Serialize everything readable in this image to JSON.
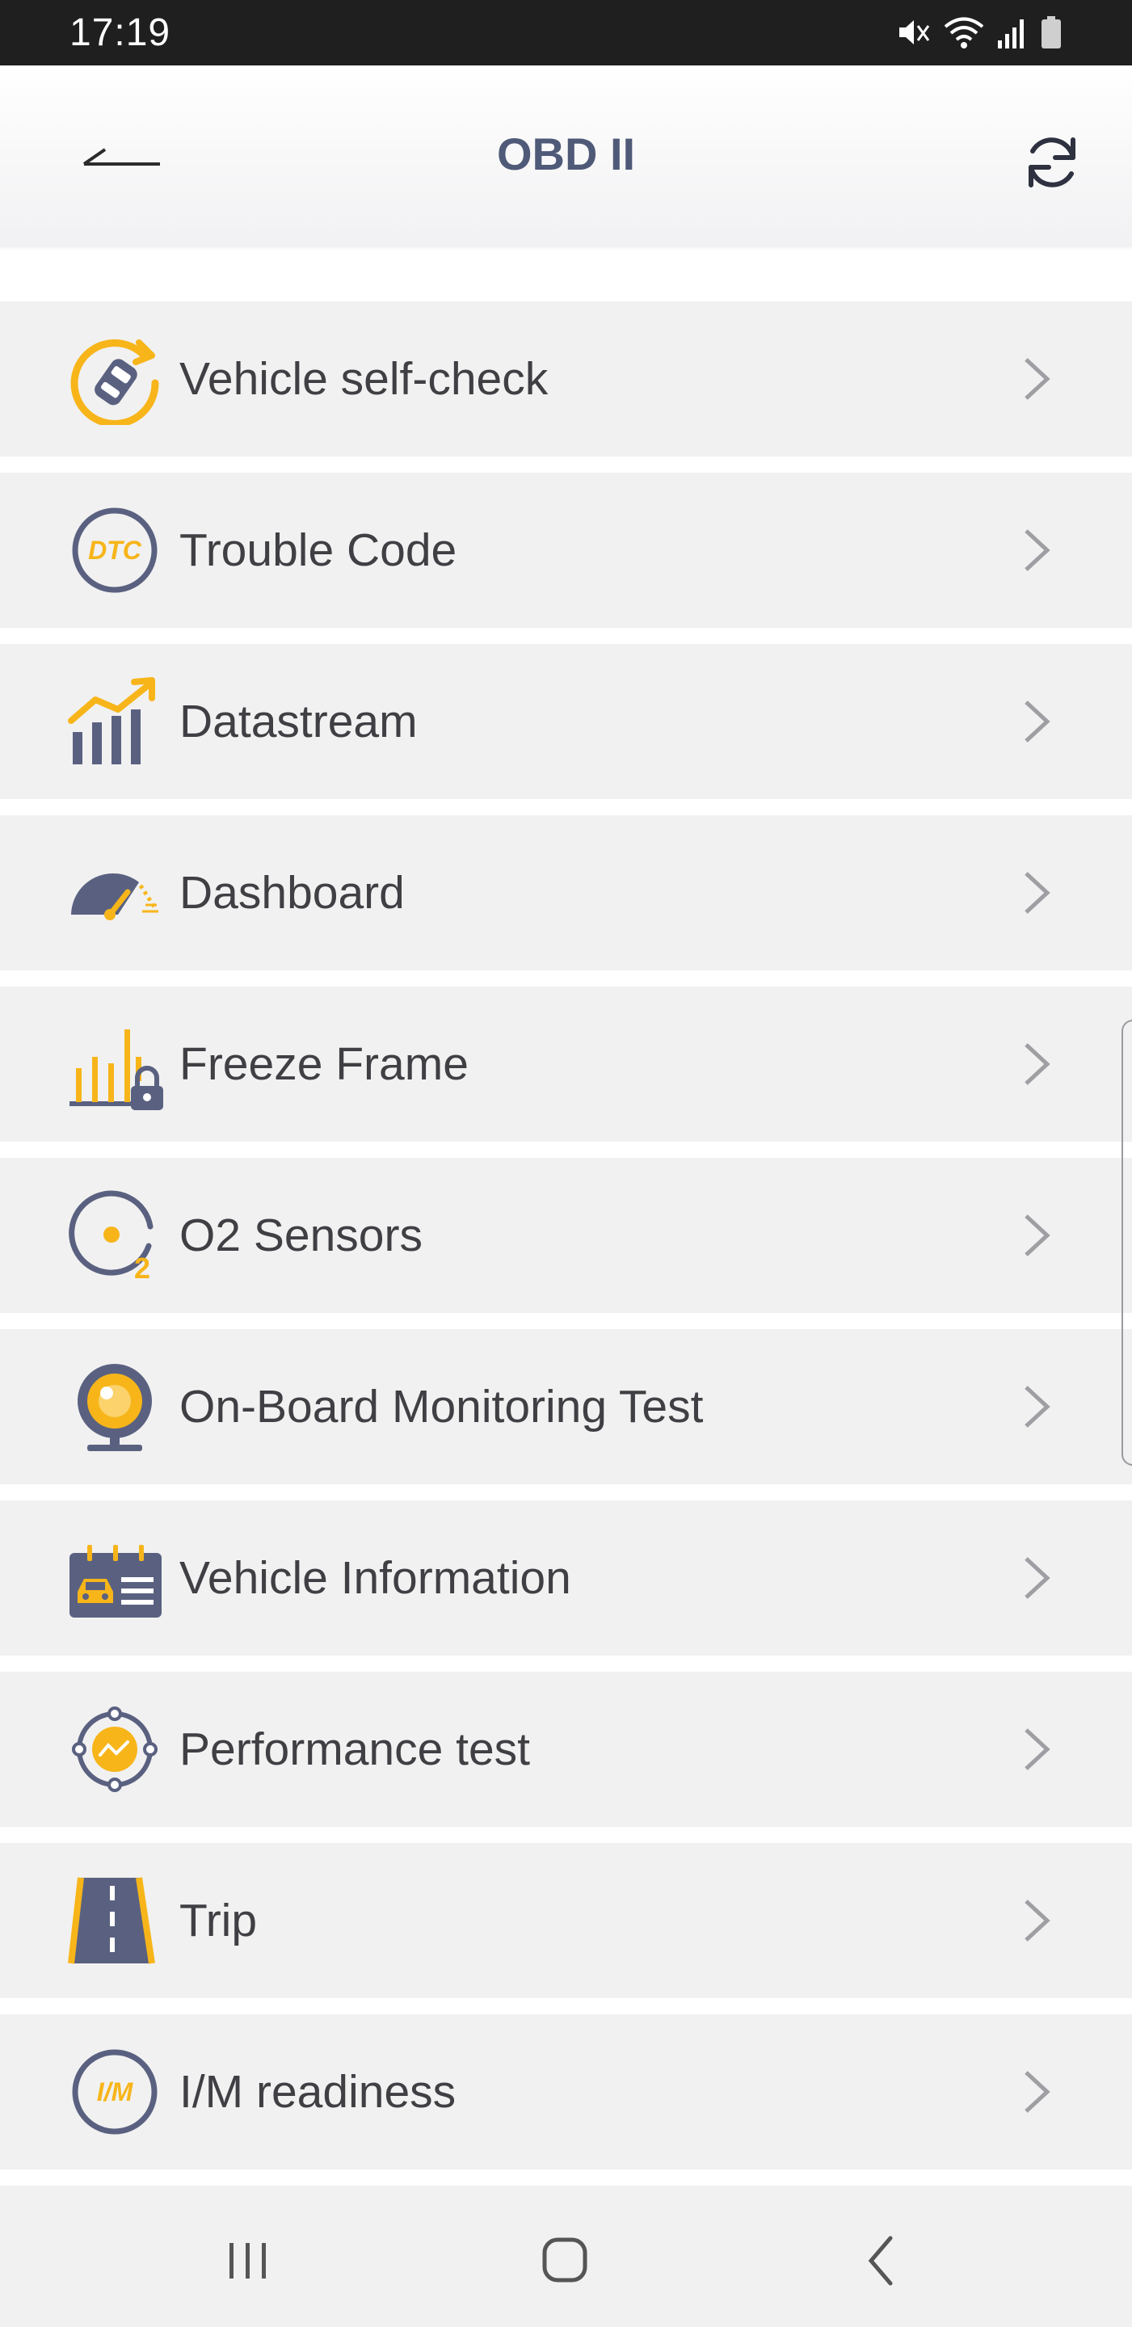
{
  "status_bar": {
    "time": "17:19",
    "icons": [
      "mute-icon",
      "wifi-icon",
      "signal-icon",
      "battery-icon"
    ]
  },
  "header": {
    "title": "OBD II",
    "back_icon": "arrow-left-icon",
    "refresh_icon": "refresh-icon"
  },
  "menu": {
    "items": [
      {
        "label": "Vehicle self-check",
        "icon": "vehicle-self-check-icon"
      },
      {
        "label": "Trouble Code",
        "icon": "dtc-icon",
        "icon_text": "DTC"
      },
      {
        "label": "Datastream",
        "icon": "datastream-chart-icon"
      },
      {
        "label": "Dashboard",
        "icon": "speedometer-icon"
      },
      {
        "label": "Freeze Frame",
        "icon": "freeze-frame-icon"
      },
      {
        "label": "O2 Sensors",
        "icon": "o2-sensor-icon",
        "icon_text": "2"
      },
      {
        "label": "On-Board Monitoring Test",
        "icon": "monitoring-camera-icon"
      },
      {
        "label": "Vehicle Information",
        "icon": "vehicle-info-card-icon"
      },
      {
        "label": "Performance test",
        "icon": "performance-test-icon"
      },
      {
        "label": "Trip",
        "icon": "road-icon"
      },
      {
        "label": "I/M readiness",
        "icon": "im-readiness-icon",
        "icon_text": "I/M"
      }
    ]
  },
  "nav_bar": {
    "recents_icon": "recents-icon",
    "home_icon": "home-icon",
    "back_icon": "nav-back-icon"
  },
  "colors": {
    "accent_yellow": "#f7b51a",
    "icon_slate": "#5a6180",
    "title_text": "#4f5a78",
    "row_background": "#f1f1f1",
    "chevron": "#9e9ea3"
  }
}
